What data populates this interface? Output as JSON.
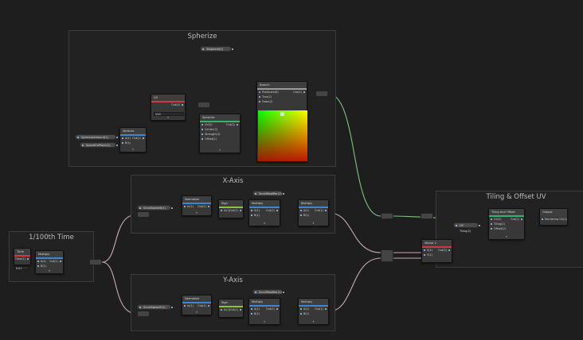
{
  "colors": {
    "background": "#1e1e1e",
    "wire_float": "#c9a9b6",
    "wire_vector": "#7ec27e",
    "wire_property": "#7d75c9",
    "wire_blue": "#8ab8e6",
    "header_time": "#d13a3a",
    "header_math": "#3b87d6",
    "header_green": "#33b36b",
    "header_lime": "#8ac33b"
  },
  "groups": {
    "sphere": "Spherize",
    "xaxis": "X-Axis",
    "yaxis": "Y-Axis",
    "time": "1/100th Time",
    "tiling": "Tiling & Offset UV"
  },
  "nodes": {
    "time": {
      "title": "Time",
      "out": "Time(1)"
    },
    "time_mul": {
      "title": "Multiply",
      "in_a": "A(1)",
      "in_b": "B(1)",
      "out": "Out(1)",
      "field": "0.01"
    },
    "sphere_property": "ToSphere(0)",
    "spherize_a": "SpherizeAmount(1)",
    "spherize_b": "SpeedOnPlane(1)",
    "uv": {
      "title": "UV",
      "out": "Out(4)",
      "channel": "UV0"
    },
    "sphere_mul": {
      "title": "Vertices",
      "in_a": "A(1)",
      "in_b": "B(1)",
      "out": "Out(1)"
    },
    "spherize": {
      "title": "Spherize",
      "in_uv": "UV(2)",
      "in_center": "Center(2)",
      "in_strength": "Strength(1)",
      "in_offset": "Offset(2)",
      "out": "Out(2)"
    },
    "branch": {
      "title": "Branch",
      "in_pred": "Predicate(B)",
      "in_true": "True(2)",
      "in_false": "False(2)",
      "out": "Out(2)"
    },
    "x_prop_speed": "ScrollSpeedX(1)",
    "x_prop_mod": "ScrollModifier(1)",
    "x_remap": {
      "title": "Normalize",
      "in": "In(1)",
      "out": "Out(1)"
    },
    "x_sign": {
      "title": "Sign",
      "in": "In(1)",
      "out": "Out(1)"
    },
    "x_mul1": {
      "title": "Multiply",
      "in_a": "A(1)",
      "in_b": "B(1)",
      "out": "Out(1)"
    },
    "x_mul2": {
      "title": "Multiply",
      "in_a": "A(1)",
      "in_b": "B(1)",
      "out": "Out(1)"
    },
    "y_prop_speed": "ScrollSpeedY(1)",
    "y_prop_mod": "ScrollModifier(1)",
    "y_remap": {
      "title": "Normalize",
      "in": "In(1)",
      "out": "Out(1)"
    },
    "y_sign": {
      "title": "Sign",
      "in": "In(1)",
      "out": "Out(1)"
    },
    "y_mul1": {
      "title": "Multiply",
      "in_a": "A(1)",
      "in_b": "B(1)",
      "out": "Out(1)"
    },
    "y_mul2": {
      "title": "Multiply",
      "in_a": "A(1)",
      "in_b": "B(1)",
      "out": "Out(1)"
    },
    "tiling_prop": "UV Tiling(2)",
    "vector2": {
      "title": "Vector 2",
      "in_x": "X(1)",
      "in_y": "Y(1)",
      "out": "Out(2)"
    },
    "tiling_offset": {
      "title": "Tiling And Offset",
      "in_uv": "UV(2)",
      "in_tiling": "Tiling(2)",
      "in_offset": "Offset(2)",
      "out": "Out(2)"
    },
    "output": {
      "title": "Output",
      "in": "Rendering UV(2)"
    }
  }
}
